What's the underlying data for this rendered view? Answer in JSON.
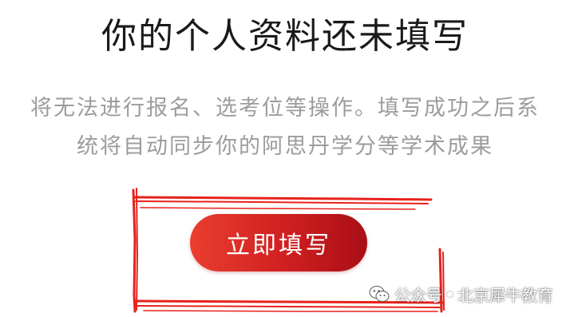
{
  "header": {
    "title": "你的个人资料还未填写"
  },
  "message": {
    "line1": "将无法进行报名、选考位等操作。填写成功之后系",
    "line2": "统将自动同步你的阿思丹学分等学术成果"
  },
  "action": {
    "fill_now_label": "立即填写"
  },
  "watermark": {
    "prefix": "公众号",
    "account": "北京犀牛教育"
  },
  "colors": {
    "button_gradient_start": "#ea3e2f",
    "button_gradient_end": "#a90f16",
    "annotation_red": "#e8211c",
    "body_text": "#9c9c9c",
    "title_text": "#1a1a1a"
  }
}
